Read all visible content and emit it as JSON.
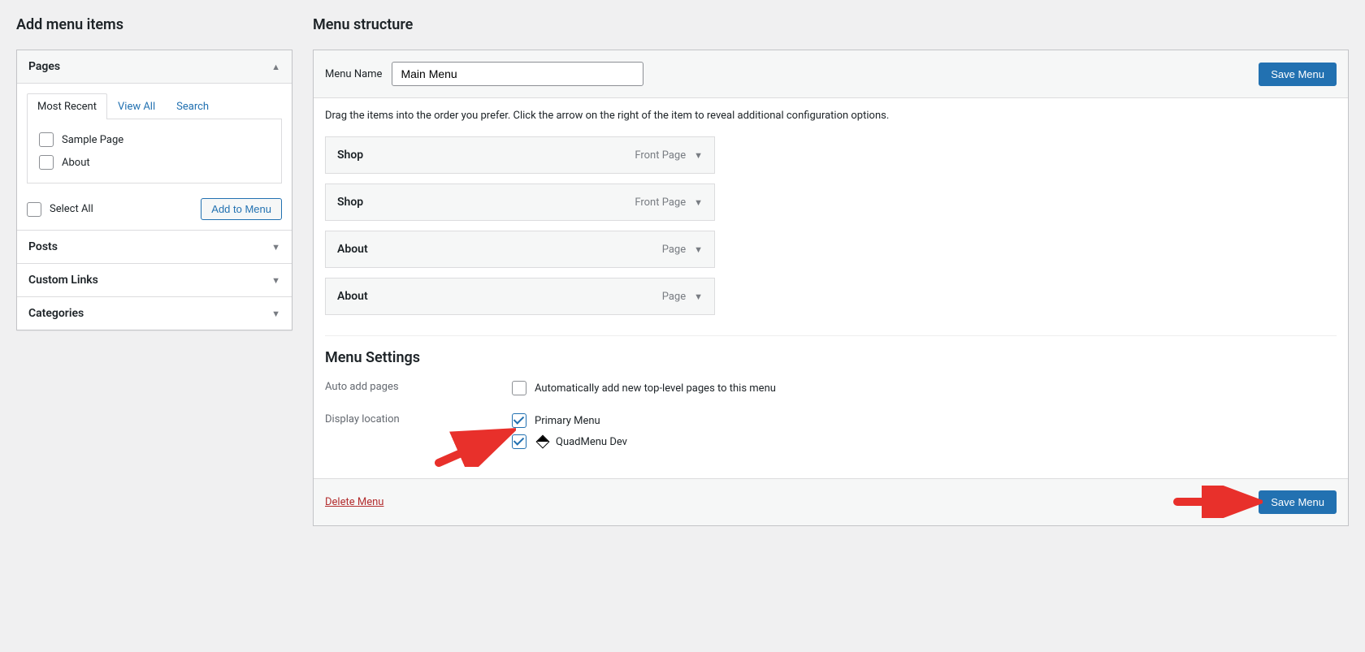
{
  "left": {
    "heading": "Add menu items",
    "accordion": [
      {
        "label": "Pages",
        "open": true
      },
      {
        "label": "Posts",
        "open": false
      },
      {
        "label": "Custom Links",
        "open": false
      },
      {
        "label": "Categories",
        "open": false
      }
    ],
    "tabs": [
      {
        "label": "Most Recent",
        "active": true
      },
      {
        "label": "View All",
        "active": false
      },
      {
        "label": "Search",
        "active": false
      }
    ],
    "page_items": [
      {
        "label": "Sample Page"
      },
      {
        "label": "About"
      }
    ],
    "select_all_label": "Select All",
    "add_to_menu_label": "Add to Menu"
  },
  "right": {
    "heading": "Menu structure",
    "menu_name_label": "Menu Name",
    "menu_name_value": "Main Menu",
    "save_button": "Save Menu",
    "instructions": "Drag the items into the order you prefer. Click the arrow on the right of the item to reveal additional configuration options.",
    "menu_items": [
      {
        "title": "Shop",
        "type": "Front Page"
      },
      {
        "title": "Shop",
        "type": "Front Page"
      },
      {
        "title": "About",
        "type": "Page"
      },
      {
        "title": "About",
        "type": "Page"
      }
    ],
    "settings_heading": "Menu Settings",
    "auto_add_label": "Auto add pages",
    "auto_add_checkbox": "Automatically add new top-level pages to this menu",
    "display_location_label": "Display location",
    "locations": [
      {
        "label": "Primary Menu",
        "checked": true,
        "icon": false
      },
      {
        "label": "QuadMenu Dev",
        "checked": true,
        "icon": true
      }
    ],
    "delete_menu_label": "Delete Menu"
  }
}
